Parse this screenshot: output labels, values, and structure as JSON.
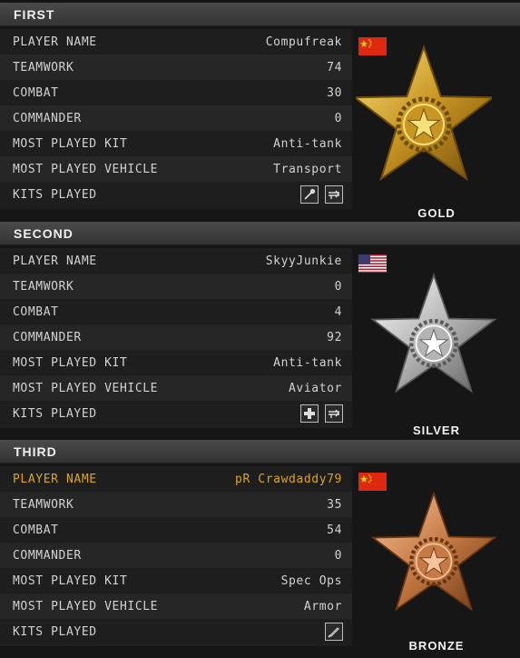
{
  "sections": [
    {
      "title": "FIRST",
      "medal": "GOLD",
      "medal_colors": [
        "#f6e27a",
        "#c89422",
        "#6e4c0c"
      ],
      "flag": "china-flag",
      "rows": [
        {
          "label": "PLAYER NAME",
          "value": "Compufreak"
        },
        {
          "label": "TEAMWORK",
          "value": "74"
        },
        {
          "label": "COMBAT",
          "value": "30"
        },
        {
          "label": "COMMANDER",
          "value": "0"
        },
        {
          "label": "MOST PLAYED KIT",
          "value": "Anti-tank"
        },
        {
          "label": "MOST PLAYED VEHICLE",
          "value": "Transport"
        },
        {
          "label": "KITS PLAYED",
          "kits": [
            "wrench-icon",
            "rocket-launcher-icon"
          ]
        }
      ]
    },
    {
      "title": "SECOND",
      "medal": "SILVER",
      "medal_colors": [
        "#ffffff",
        "#b4b4b4",
        "#5a5a5a"
      ],
      "flag": "usa-flag",
      "rows": [
        {
          "label": "PLAYER NAME",
          "value": "SkyyJunkie"
        },
        {
          "label": "TEAMWORK",
          "value": "0"
        },
        {
          "label": "COMBAT",
          "value": "4"
        },
        {
          "label": "COMMANDER",
          "value": "92"
        },
        {
          "label": "MOST PLAYED KIT",
          "value": "Anti-tank"
        },
        {
          "label": "MOST PLAYED VEHICLE",
          "value": "Aviator"
        },
        {
          "label": "KITS PLAYED",
          "kits": [
            "medic-cross-icon",
            "rocket-launcher-icon"
          ]
        }
      ]
    },
    {
      "title": "THIRD",
      "medal": "BRONZE",
      "medal_colors": [
        "#f7c39a",
        "#c67a45",
        "#6a3612"
      ],
      "flag": "china-flag",
      "highlight_color": "#d9a51e",
      "rows": [
        {
          "label": "PLAYER NAME",
          "value": "pR Crawdaddy79",
          "highlight": true
        },
        {
          "label": "TEAMWORK",
          "value": "35"
        },
        {
          "label": "COMBAT",
          "value": "54"
        },
        {
          "label": "COMMANDER",
          "value": "0"
        },
        {
          "label": "MOST PLAYED KIT",
          "value": "Spec Ops"
        },
        {
          "label": "MOST PLAYED VEHICLE",
          "value": "Armor"
        },
        {
          "label": "KITS PLAYED",
          "kits": [
            "knife-icon"
          ]
        }
      ]
    }
  ]
}
